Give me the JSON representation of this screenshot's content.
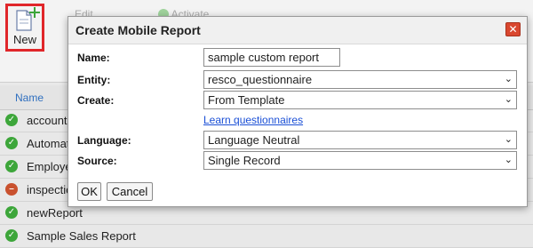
{
  "ribbon": {
    "new_label": "New",
    "edit_label": "Edit",
    "activate_label": "Activate"
  },
  "grid": {
    "column_name": "Name",
    "rows": [
      {
        "name": "account",
        "status": "ok"
      },
      {
        "name": "Automation",
        "status": "ok"
      },
      {
        "name": "Employee",
        "status": "ok"
      },
      {
        "name": "inspection",
        "status": "error"
      },
      {
        "name": "newReport",
        "status": "ok"
      },
      {
        "name": "Sample Sales Report",
        "status": "ok"
      }
    ]
  },
  "dialog": {
    "title": "Create Mobile Report",
    "close_glyph": "✕",
    "name_label": "Name:",
    "name_value": "sample custom report",
    "entity_label": "Entity:",
    "entity_value": "resco_questionnaire",
    "create_label": "Create:",
    "create_value": "From Template",
    "learn_link": "Learn questionnaires",
    "language_label": "Language:",
    "language_value": "Language Neutral",
    "source_label": "Source:",
    "source_value": "Single Record",
    "ok_label": "OK",
    "cancel_label": "Cancel"
  },
  "colors": {
    "highlight": "#e0262a",
    "link": "#1a4fd6",
    "ok_status": "#3da63a",
    "error_status": "#c9512e",
    "close_button": "#d9472f"
  }
}
